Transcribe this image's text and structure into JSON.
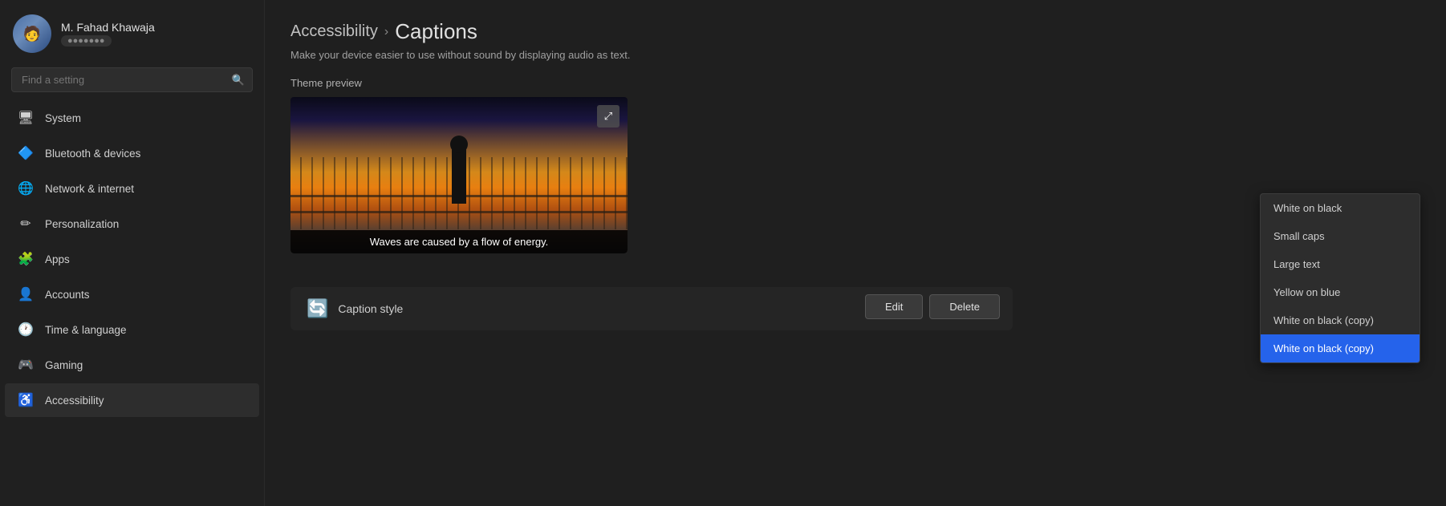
{
  "sidebar": {
    "user": {
      "name": "M. Fahad Khawaja",
      "subtitle": "●●●●●●●"
    },
    "search": {
      "placeholder": "Find a setting"
    },
    "items": [
      {
        "id": "system",
        "label": "System",
        "icon": "🖥",
        "active": false
      },
      {
        "id": "bluetooth",
        "label": "Bluetooth & devices",
        "icon": "🔷",
        "active": false
      },
      {
        "id": "network",
        "label": "Network & internet",
        "icon": "🌐",
        "active": false
      },
      {
        "id": "personalization",
        "label": "Personalization",
        "icon": "✏",
        "active": false
      },
      {
        "id": "apps",
        "label": "Apps",
        "icon": "🧩",
        "active": false
      },
      {
        "id": "accounts",
        "label": "Accounts",
        "icon": "👤",
        "active": false
      },
      {
        "id": "time",
        "label": "Time & language",
        "icon": "🕐",
        "active": false
      },
      {
        "id": "gaming",
        "label": "Gaming",
        "icon": "🎮",
        "active": false
      },
      {
        "id": "accessibility",
        "label": "Accessibility",
        "icon": "♿",
        "active": true
      }
    ]
  },
  "main": {
    "breadcrumb_parent": "Accessibility",
    "breadcrumb_separator": "›",
    "breadcrumb_current": "Captions",
    "subtitle": "Make your device easier to use without sound by displaying audio as text.",
    "section_label": "Theme preview",
    "preview_caption_text": "Waves are caused by a flow of energy.",
    "expand_icon": "⤢",
    "caption_style_label": "Caption style",
    "dropdown": {
      "items": [
        {
          "id": "white-on-black",
          "label": "White on black",
          "selected": false
        },
        {
          "id": "small-caps",
          "label": "Small caps",
          "selected": false
        },
        {
          "id": "large-text",
          "label": "Large text",
          "selected": false
        },
        {
          "id": "yellow-on-blue",
          "label": "Yellow on blue",
          "selected": false
        },
        {
          "id": "white-on-black-copy",
          "label": "White on black (copy)",
          "selected": false
        },
        {
          "id": "white-on-black-copy2",
          "label": "White on black (copy)",
          "selected": true
        }
      ]
    },
    "edit_button": "Edit",
    "delete_button": "Delete"
  }
}
